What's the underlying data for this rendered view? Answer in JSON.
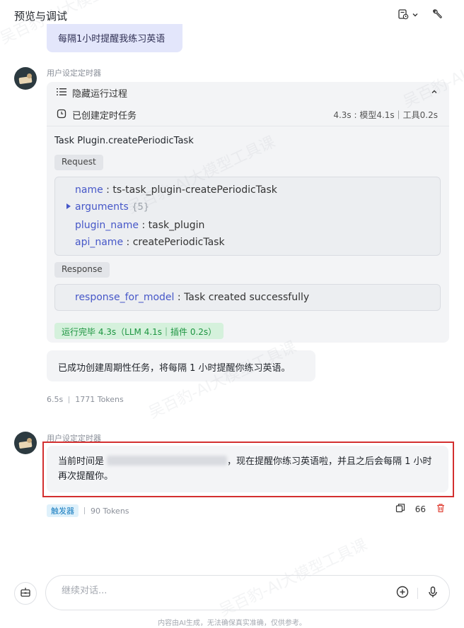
{
  "header": {
    "title": "预览与调试",
    "icons": [
      "schedule-icon",
      "chevron-down-icon",
      "wrench-icon"
    ]
  },
  "user_message": {
    "text": "每隔1小时提醒我练习英语"
  },
  "bot_name": "用户设定定时器",
  "process": {
    "toggle_label": "隐藏运行过程",
    "task_label": "已创建定时任务",
    "timing": "4.3s : 模型4.1s｜工具0.2s",
    "tool_call": "Task Plugin.createPeriodicTask",
    "request_label": "Request",
    "request": [
      {
        "key": "name",
        "value": "ts-task_plugin-createPeriodicTask"
      },
      {
        "key": "arguments",
        "count": "{5}"
      },
      {
        "key": "plugin_name",
        "value": "task_plugin"
      },
      {
        "key": "api_name",
        "value": "createPeriodicTask"
      }
    ],
    "response_label": "Response",
    "response": [
      {
        "key": "response_for_model",
        "value": "Task created successfully"
      }
    ],
    "status": "运行完毕 4.3s（LLM 4.1s｜插件 0.2s）"
  },
  "reply": {
    "text": "已成功创建周期性任务，将每隔 1 小时提醒你练习英语。",
    "time": "6.5s",
    "tokens": "1771 Tokens"
  },
  "trigger_message": {
    "prefix": "当前时间是",
    "suffix": "，现在提醒你练习英语啦，并且之后会每隔 1 小时再次提醒你。",
    "badge": "触发器",
    "tokens": "90 Tokens",
    "count": "66"
  },
  "input": {
    "placeholder": "继续对话..."
  },
  "footer": "内容由AI生成，无法确保真实准确，仅供参考。",
  "watermark": "吴百豹-AI大模型工具课",
  "colors": {
    "accent": "#4657c8",
    "user_bubble": "#e3e6fb",
    "success": "#1c9440",
    "highlight": "#d32f2f"
  }
}
